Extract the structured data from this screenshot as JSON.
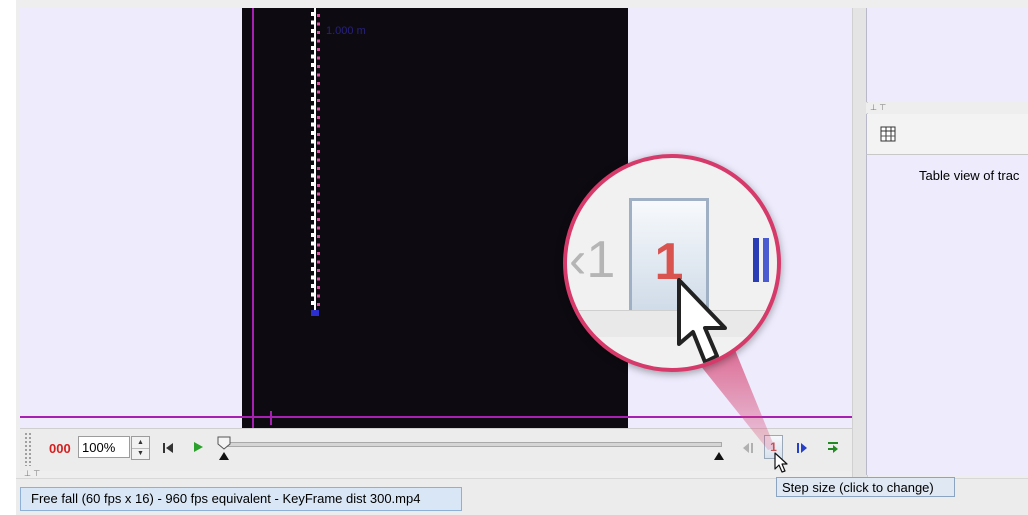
{
  "video": {
    "track_label": "1.000 m"
  },
  "player": {
    "frame_number": "000",
    "zoom_value": "100%",
    "step_size": "1",
    "magnified_step": "1",
    "magnified_prev": "‹1"
  },
  "table_panel": {
    "caption": "Table view of trac"
  },
  "status": {
    "file_tab": "Free fall (60 fps x 16) - 960 fps equivalent - KeyFrame dist 300.mp4",
    "tooltip": "Step size (click to change)"
  },
  "colors": {
    "magnifier_border": "#d63a6a",
    "marker_line": "#a81fb4",
    "frame_number": "#d42020"
  }
}
